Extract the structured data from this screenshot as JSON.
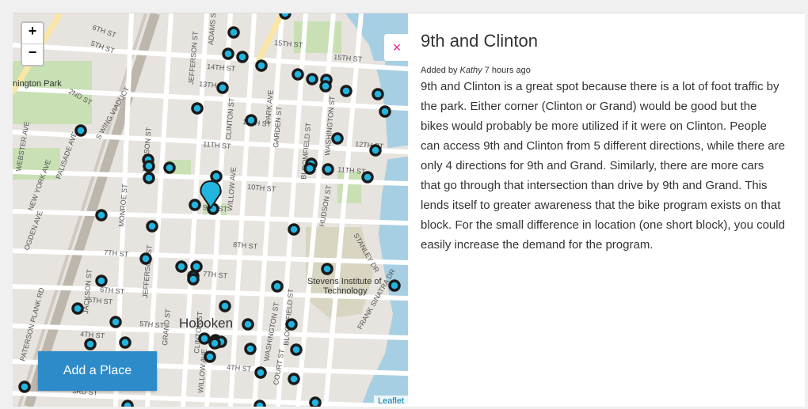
{
  "map": {
    "zoom_in": "+",
    "zoom_out": "−",
    "add_place_label": "Add a Place",
    "attribution": "Leaflet",
    "labels": {
      "hoboken": "Hoboken",
      "stevens1": "Stevens Institute of",
      "stevens2": "Technology",
      "park": "nington Park",
      "s15a": "15TH ST",
      "s15b": "15TH ST",
      "s14": "14TH ST",
      "s13": "13TH ST",
      "s12": "12TH ST",
      "s11a": "11TH ST",
      "s11b": "11TH ST",
      "s10": "10TH ST",
      "s9": "9TH ST",
      "s8": "8TH ST",
      "s7a": "7TH ST",
      "s7b": "7TH ST",
      "s6a": "6TH ST",
      "s6b": "6TH ST",
      "s5a": "5TH ST",
      "s5b": "5TH ST",
      "s4a": "4TH ST",
      "s4b": "4TH ST",
      "s3": "3RD ST",
      "s2": "2ND ST",
      "adams": "ADAMS ST",
      "jeff": "JEFFERSON ST",
      "clinton": "CLINTON ST",
      "willow": "WILLOW AVE",
      "park_ave": "PARK AVE",
      "garden": "GARDEN ST",
      "bloom": "BLOOMFIELD ST",
      "wash": "WASHINGTON ST",
      "hudson": "HUDSON ST",
      "court": "COURT ST",
      "grand": "GRAND ST",
      "monroe": "MONROE ST",
      "madison": "MADISON ST",
      "swing": "S WING VIADUCT",
      "palisade": "PALISADE AVE",
      "webster": "WEBSTER AVE",
      "newyork": "NEW YORK AVE",
      "ogden": "OGDEN AVE",
      "paterson": "PATERSON PLANK RD",
      "jackson": "JACKSON ST",
      "frank": "FRANK SINATRA DR",
      "stanley": "STANLEY DR",
      "s8b": "8TH ST",
      "s12b": "12TH ST"
    }
  },
  "detail": {
    "close_icon": "×",
    "title": "9th and Clinton",
    "added_by_prefix": "Added by",
    "author": "Kathy",
    "time_ago": "7 hours ago",
    "body": "9th and Clinton is a great spot because there is a lot of foot traffic by the park. Either corner (Clinton or Grand) would be good but the bikes would probably be more utilized if it were on Clinton. People can access 9th and Clinton from 5 different directions, while there are only 4 directions for 9th and Grand. Similarly, there are more cars that go through that intersection than drive by 9th and Grand. This lends itself to greater awareness that the bike program exists on that block. For the small difference in location (one short block), you could easily increase the demand for the program."
  },
  "colors": {
    "marker_fill": "#22b5e0",
    "marker_stroke": "#1a1a1a",
    "water": "#a7cfe3",
    "park": "#c8e0b4",
    "button_blue": "#2e8bc9",
    "close_pink": "#e91e8c"
  }
}
